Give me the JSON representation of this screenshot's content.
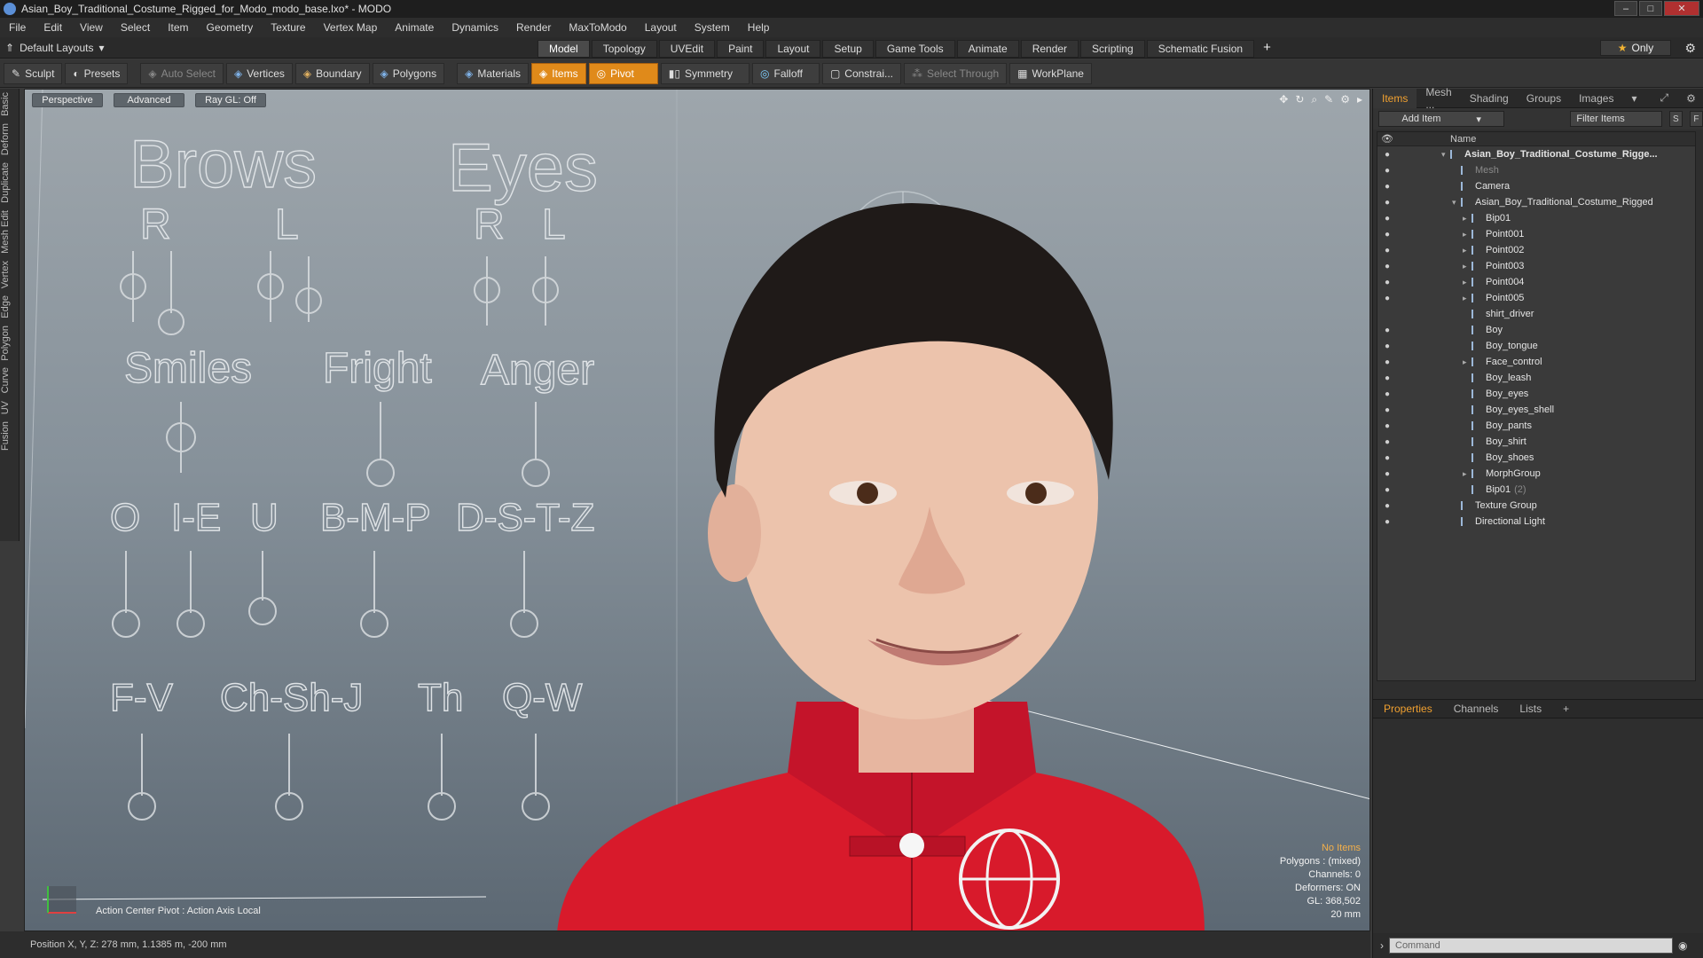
{
  "window": {
    "title": "Asian_Boy_Traditional_Costume_Rigged_for_Modo_modo_base.lxo* - MODO"
  },
  "menu": [
    "File",
    "Edit",
    "View",
    "Select",
    "Item",
    "Geometry",
    "Texture",
    "Vertex Map",
    "Animate",
    "Dynamics",
    "Render",
    "MaxToModo",
    "Layout",
    "System",
    "Help"
  ],
  "layoutbar": {
    "layout_label": "Default Layouts",
    "tabs": [
      "Model",
      "Topology",
      "UVEdit",
      "Paint",
      "Layout",
      "Setup",
      "Game Tools",
      "Animate",
      "Render",
      "Scripting",
      "Schematic Fusion"
    ],
    "active_tab": "Model",
    "only_label": "Only"
  },
  "toolbar": {
    "sculpt": "Sculpt",
    "presets": "Presets",
    "auto_select": "Auto Select",
    "vertices": "Vertices",
    "boundary": "Boundary",
    "polygons": "Polygons",
    "materials": "Materials",
    "items": "Items",
    "pivot": "Pivot",
    "symmetry": "Symmetry",
    "falloff": "Falloff",
    "constraints": "Constrai...",
    "select_through": "Select Through",
    "workplane": "WorkPlane"
  },
  "left_tabs": [
    "Basic",
    "Deform",
    "Duplicate",
    "Mesh Edit",
    "Vertex",
    "Edge",
    "Polygon",
    "Curve",
    "UV",
    "Fusion"
  ],
  "viewport": {
    "view_mode": "Perspective",
    "shading": "Advanced",
    "raygl": "Ray GL: Off",
    "footer": "Action Center Pivot : Action Axis Local",
    "stats": [
      "No Items",
      "Polygons : (mixed)",
      "Channels: 0",
      "Deformers: ON",
      "GL: 368,502",
      "20 mm"
    ],
    "rig_labels": {
      "brows": "Brows",
      "eyes": "Eyes",
      "r": "R",
      "l": "L",
      "smiles": "Smiles",
      "fright": "Fright",
      "anger": "Anger",
      "o": "O",
      "ie": "I-E",
      "u": "U",
      "bmp": "B-M-P",
      "dstz": "D-S-T-Z",
      "fv": "F-V",
      "chshj": "Ch-Sh-J",
      "th": "Th",
      "qw": "Q-W"
    }
  },
  "status": {
    "position": "Position X, Y, Z:  278 mm, 1.1385 m, -200 mm"
  },
  "items_panel": {
    "tabs": [
      "Items",
      "Mesh ...",
      "Shading",
      "Groups",
      "Images"
    ],
    "add_item": "Add Item",
    "filter": "Filter Items",
    "s_btn": "S",
    "f_btn": "F",
    "name_header": "Name",
    "rows": [
      {
        "label": "Asian_Boy_Traditional_Costume_Rigge...",
        "eye": true
      },
      {
        "label": "Mesh",
        "eye": true
      },
      {
        "label": "Camera",
        "eye": true
      },
      {
        "label": "Asian_Boy_Traditional_Costume_Rigged",
        "eye": true
      },
      {
        "label": "Bip01",
        "eye": true
      },
      {
        "label": "Point001",
        "eye": true
      },
      {
        "label": "Point002",
        "eye": true
      },
      {
        "label": "Point003",
        "eye": true
      },
      {
        "label": "Point004",
        "eye": true
      },
      {
        "label": "Point005",
        "eye": true
      },
      {
        "label": "shirt_driver",
        "eye": false
      },
      {
        "label": "Boy",
        "eye": true
      },
      {
        "label": "Boy_tongue",
        "eye": true
      },
      {
        "label": "Face_control",
        "eye": true
      },
      {
        "label": "Boy_leash",
        "eye": true
      },
      {
        "label": "Boy_eyes",
        "eye": true
      },
      {
        "label": "Boy_eyes_shell",
        "eye": true
      },
      {
        "label": "Boy_pants",
        "eye": true
      },
      {
        "label": "Boy_shirt",
        "eye": true
      },
      {
        "label": "Boy_shoes",
        "eye": true
      },
      {
        "label": "MorphGroup",
        "eye": true
      },
      {
        "label": "Bip01",
        "eye": true
      },
      {
        "label": "Texture Group",
        "eye": true
      },
      {
        "label": "Directional Light",
        "eye": true
      }
    ],
    "bip_suffix": "(2)"
  },
  "props_panel": {
    "tabs": [
      "Properties",
      "Channels",
      "Lists"
    ],
    "command_placeholder": "Command"
  },
  "colors": {
    "accent": "#f0a030",
    "pivot": "#e08a1a",
    "shirt": "#d8182a"
  }
}
